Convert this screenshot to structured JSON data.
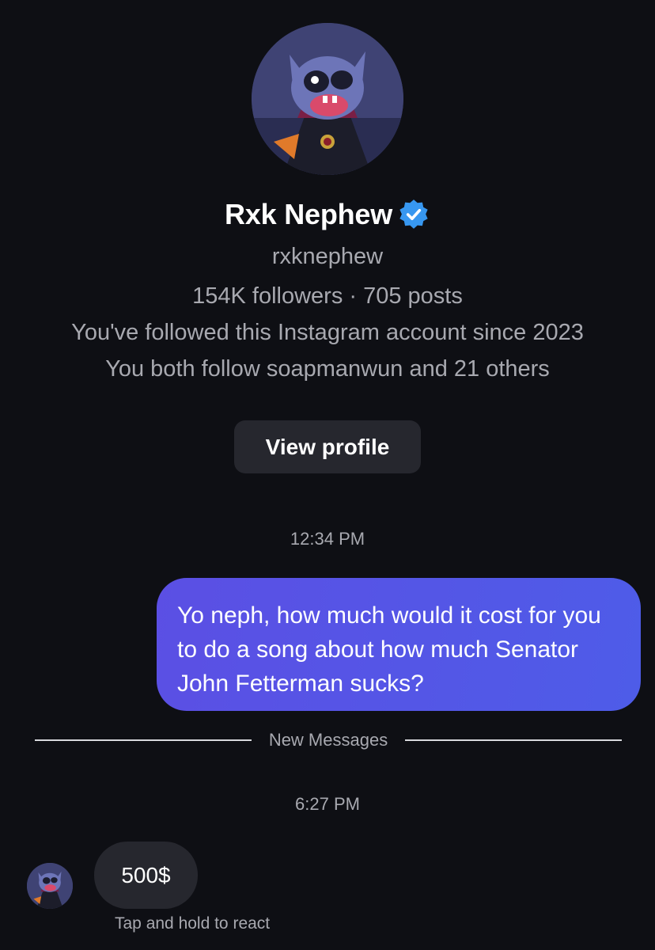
{
  "profile": {
    "display_name": "Rxk Nephew",
    "verified": true,
    "username": "rxknephew",
    "stats": "154K followers · 705 posts",
    "followed_since": "You've followed this Instagram account since 2023",
    "mutuals": "You both follow soapmanwun and 21 others",
    "view_profile_label": "View profile",
    "avatar_icon": "stitch-vampire-avatar"
  },
  "messages": [
    {
      "timestamp": "12:34 PM",
      "direction": "outgoing",
      "text": "Yo neph, how much would it cost for you to do a song about how much Senator John Fetterman sucks?"
    },
    {
      "divider": "New Messages"
    },
    {
      "timestamp": "6:27 PM",
      "direction": "incoming",
      "text": "500$",
      "hint": "Tap and hold to react"
    }
  ],
  "colors": {
    "background": "#0e0f14",
    "outgoing_bubble": "#5653e6",
    "incoming_bubble": "#26272e",
    "secondary_text": "#a8a9b0",
    "verified_badge": "#3797f0"
  }
}
